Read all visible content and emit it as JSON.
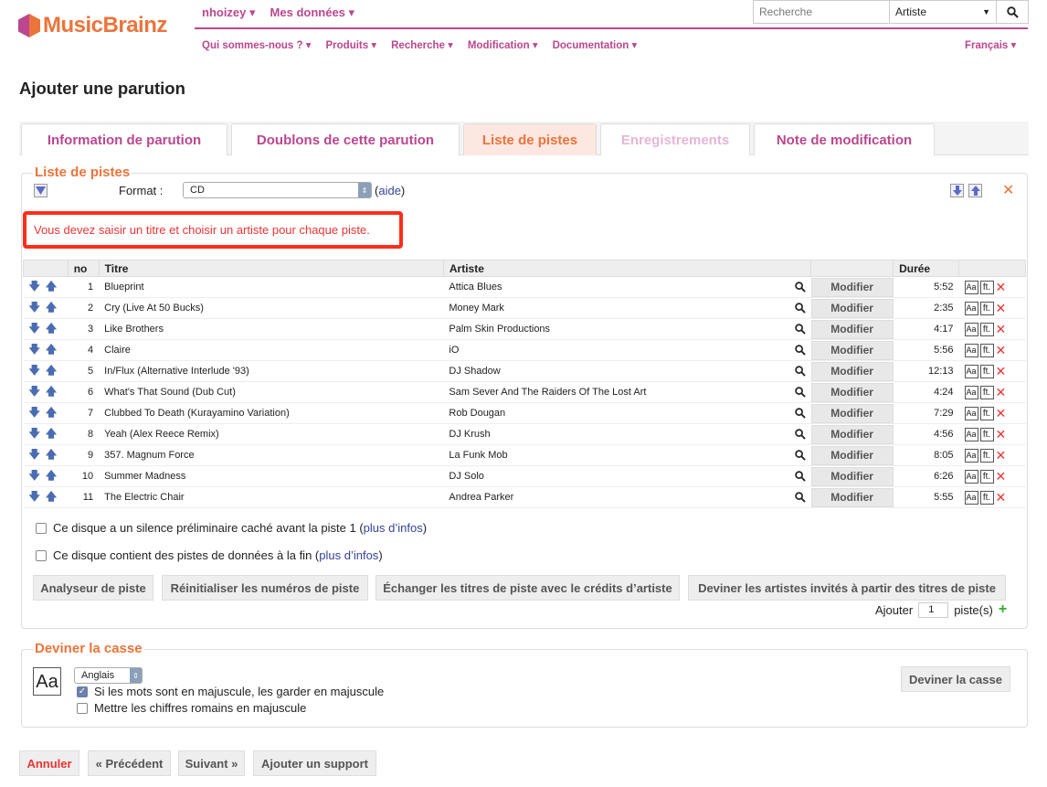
{
  "header": {
    "logo_text": "MusicBrainz",
    "user_menu": [
      "nhoizey ▾",
      "Mes données ▾"
    ],
    "search_placeholder": "Recherche",
    "search_type": "Artiste",
    "nav": [
      "Qui sommes-nous ? ▾",
      "Produits ▾",
      "Recherche ▾",
      "Modification ▾",
      "Documentation ▾"
    ],
    "language": "Français ▾"
  },
  "page_title": "Ajouter une parution",
  "tabs": [
    "Information de parution",
    "Doublons de cette parution",
    "Liste de pistes",
    "Enregistrements",
    "Note de modification"
  ],
  "tracklist": {
    "legend": "Liste de pistes",
    "format_label": "Format :",
    "format_value": "CD",
    "help_link": "aide",
    "error": "Vous devez saisir un titre et choisir un artiste pour chaque piste.",
    "columns": {
      "no": "no",
      "title": "Titre",
      "artist": "Artiste",
      "duration": "Durée"
    },
    "edit_label": "Modifier",
    "feat_label": "ft.",
    "tracks": [
      {
        "no": "1",
        "title": "Blueprint",
        "artist": "Attica Blues",
        "duration": "5:52"
      },
      {
        "no": "2",
        "title": "Cry (Live At 50 Bucks)",
        "artist": "Money Mark",
        "duration": "2:35"
      },
      {
        "no": "3",
        "title": "Like Brothers",
        "artist": "Palm Skin Productions",
        "duration": "4:17"
      },
      {
        "no": "4",
        "title": "Claire",
        "artist": "iO",
        "duration": "5:56"
      },
      {
        "no": "5",
        "title": "In/Flux (Alternative Interlude '93)",
        "artist": "DJ Shadow",
        "duration": "12:13"
      },
      {
        "no": "6",
        "title": "What's That Sound (Dub Cut)",
        "artist": "Sam Sever And The Raiders Of The Lost Art",
        "duration": "4:24"
      },
      {
        "no": "7",
        "title": "Clubbed To Death (Kurayamino Variation)",
        "artist": "Rob Dougan",
        "duration": "7:29"
      },
      {
        "no": "8",
        "title": "Yeah (Alex Reece Remix)",
        "artist": "DJ Krush",
        "duration": "4:56"
      },
      {
        "no": "9",
        "title": "357. Magnum Force",
        "artist": "La Funk Mob",
        "duration": "8:05"
      },
      {
        "no": "10",
        "title": "Summer Madness",
        "artist": "DJ Solo",
        "duration": "6:26"
      },
      {
        "no": "11",
        "title": "The Electric Chair",
        "artist": "Andrea Parker",
        "duration": "5:55"
      }
    ],
    "pregap_text": "Ce disque a un silence préliminaire caché avant la piste 1",
    "data_tracks_text": "Ce disque contient des pistes de données à la fin",
    "more_info": "plus d’infos",
    "buttons": [
      "Analyseur de piste",
      "Réinitialiser les numéros de piste",
      "Échanger les titres de piste avec le crédits d’artiste",
      "Deviner les artistes invités à partir des titres de piste"
    ],
    "add_label": "Ajouter",
    "add_value": "1",
    "add_unit": "piste(s)"
  },
  "guess_case": {
    "legend": "Deviner la casse",
    "language": "Anglais",
    "keep_upper": "Si les mots sont en majuscule, les garder en majuscule",
    "roman_upper": "Mettre les chiffres romains en majuscule",
    "button": "Deviner la casse",
    "icon_text": "Aa"
  },
  "footer": {
    "cancel": "Annuler",
    "previous": "« Précédent",
    "next": "Suivant »",
    "add_medium": "Ajouter un support"
  },
  "colors": {
    "brand_orange": "#eb743b",
    "brand_purple": "#ba478f",
    "error_red": "#ff2d1a"
  }
}
